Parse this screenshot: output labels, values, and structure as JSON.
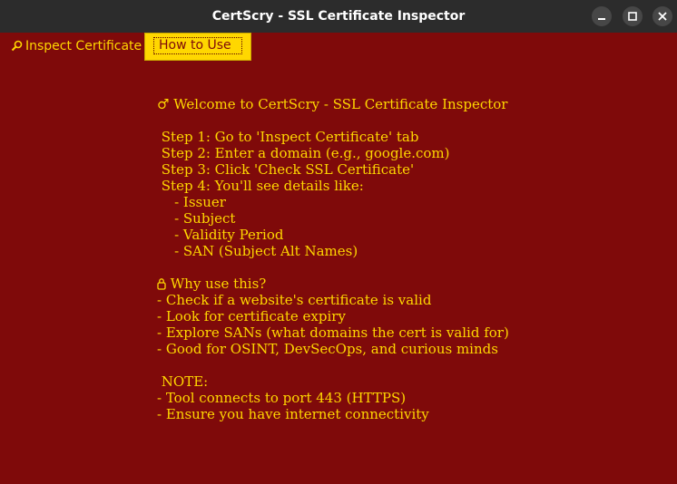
{
  "window": {
    "title": "CertScry - SSL Certificate Inspector",
    "minimize_icon": "minimize-icon",
    "maximize_icon": "maximize-icon",
    "close_icon": "close-icon"
  },
  "tabs": [
    {
      "label": "Inspect Certificate",
      "icon": "magnifier-icon",
      "selected": false
    },
    {
      "label": "How to Use",
      "selected": true
    }
  ],
  "colors": {
    "background": "#7f0a0a",
    "text": "#ffd700",
    "titlebar": "#2c2c2c",
    "selected_tab": "#ffd700"
  },
  "help": {
    "welcome": "♂ Welcome to CertScry - SSL Certificate Inspector",
    "step1": " Step 1: Go to 'Inspect Certificate' tab",
    "step2": " Step 2: Enter a domain (e.g., google.com)",
    "step3": " Step 3: Click 'Check SSL Certificate'",
    "step4": " Step 4: You'll see details like:",
    "detail_issuer": "    - Issuer",
    "detail_subject": "    - Subject",
    "detail_validity": "    - Validity Period",
    "detail_san": "    - SAN (Subject Alt Names)",
    "why_title": " Why use this?",
    "why_icon": "lock-icon",
    "why_1": "- Check if a website's certificate is valid",
    "why_2": "- Look for certificate expiry",
    "why_3": "- Explore SANs (what domains the cert is valid for)",
    "why_4": "- Good for OSINT, DevSecOps, and curious minds",
    "note_title": " NOTE:",
    "note_1": "- Tool connects to port 443 (HTTPS)",
    "note_2": "- Ensure you have internet connectivity"
  }
}
